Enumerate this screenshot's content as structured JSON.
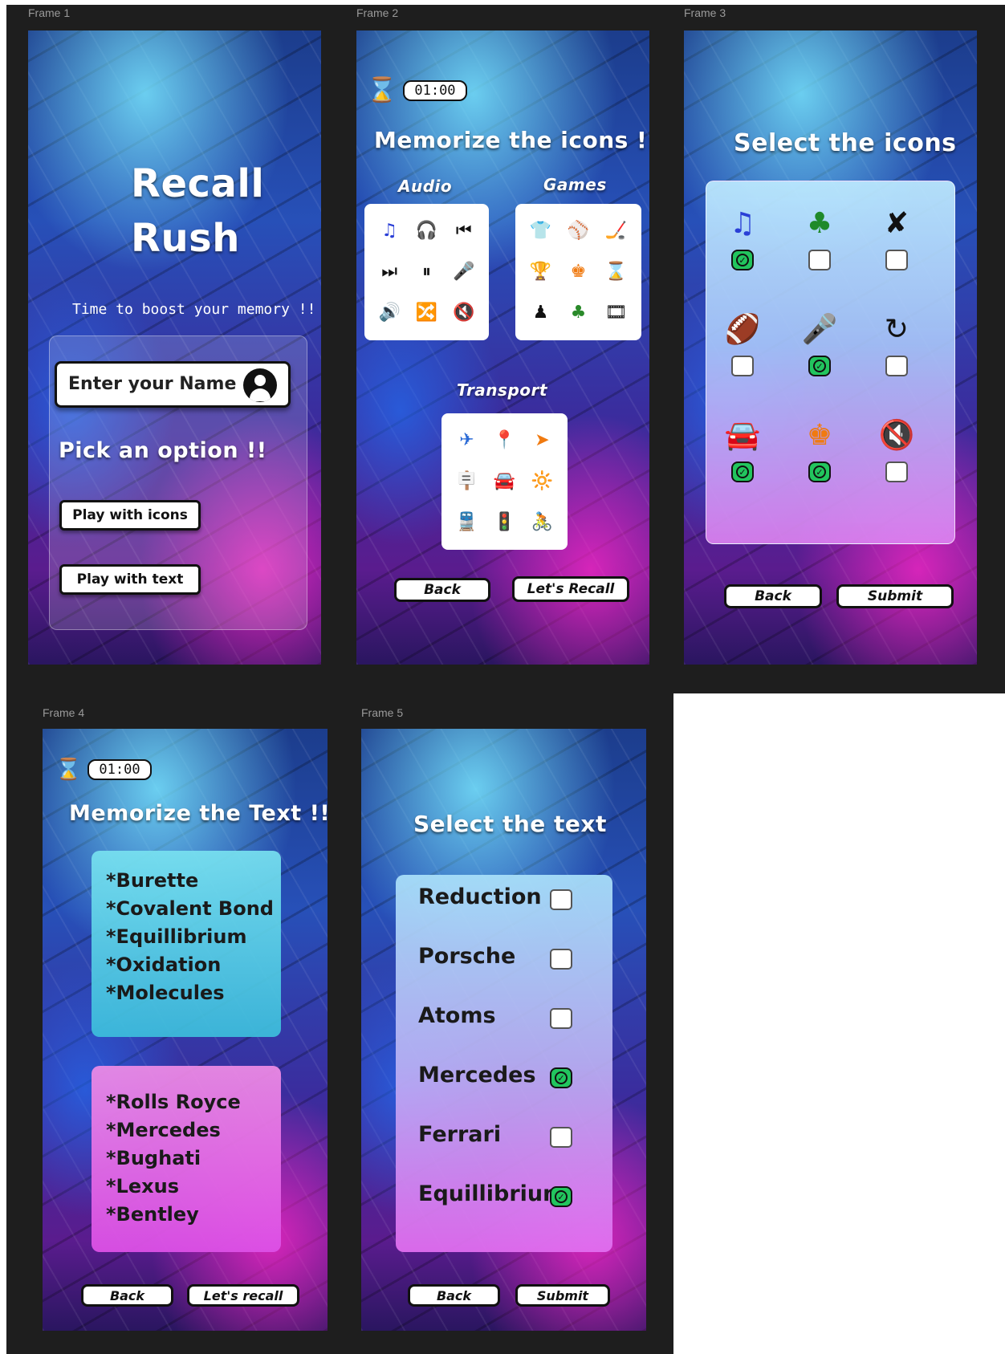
{
  "frame1": {
    "label": "Frame 1",
    "title_line1": "Recall",
    "title_line2": "Rush",
    "tagline": "Time to boost your memory !!",
    "name_placeholder": "Enter your Name",
    "pick_label": "Pick an option !!",
    "btn_icons": "Play with icons",
    "btn_text": "Play with text"
  },
  "frame2": {
    "label": "Frame 2",
    "timer": "01:00",
    "heading": "Memorize the icons !!",
    "audio_label": "Audio",
    "games_label": "Games",
    "transport_label": "Transport",
    "back": "Back",
    "recall": "Let's Recall",
    "audio_icons": [
      {
        "name": "music-note-icon",
        "glyph": "♫",
        "color": "#2a3fd6"
      },
      {
        "name": "headphones-icon",
        "glyph": "🎧",
        "color": "#111111"
      },
      {
        "name": "skip-back-icon",
        "glyph": "⏮",
        "color": "#111111"
      },
      {
        "name": "skip-forward-icon",
        "glyph": "⏭",
        "color": "#111111"
      },
      {
        "name": "pause-icon",
        "glyph": "⏸",
        "color": "#111111"
      },
      {
        "name": "microphone-icon",
        "glyph": "🎤",
        "color": "#d61f1f"
      },
      {
        "name": "volume-icon",
        "glyph": "🔊",
        "color": "#f4b400"
      },
      {
        "name": "shuffle-icon",
        "glyph": "🔀",
        "color": "#2fa84f"
      },
      {
        "name": "mute-icon",
        "glyph": "🔇",
        "color": "#d61f1f"
      }
    ],
    "games_icons": [
      {
        "name": "shirt-icon",
        "glyph": "👕",
        "color": "#a020c8"
      },
      {
        "name": "baseball-icon",
        "glyph": "⚾",
        "color": "#111111"
      },
      {
        "name": "hockey-icon",
        "glyph": "🏒",
        "color": "#e08a00"
      },
      {
        "name": "trophy-icon",
        "glyph": "🏆",
        "color": "#f4b400"
      },
      {
        "name": "chess-king-icon",
        "glyph": "♚",
        "color": "#f07a10"
      },
      {
        "name": "hourglass-icon",
        "glyph": "⌛",
        "color": "#111111"
      },
      {
        "name": "chess-pawn-icon",
        "glyph": "♟",
        "color": "#111111"
      },
      {
        "name": "club-icon",
        "glyph": "♣",
        "color": "#2a8a2a"
      },
      {
        "name": "film-icon",
        "glyph": "🎞",
        "color": "#111111"
      }
    ],
    "transport_icons": [
      {
        "name": "plane-icon",
        "glyph": "✈",
        "color": "#2a6ad6"
      },
      {
        "name": "location-pin-icon",
        "glyph": "📍",
        "color": "#e0405a"
      },
      {
        "name": "navigation-arrow-icon",
        "glyph": "➤",
        "color": "#f07a10"
      },
      {
        "name": "signpost-icon",
        "glyph": "🪧",
        "color": "#8a5a20"
      },
      {
        "name": "car-icon",
        "glyph": "🚘",
        "color": "#111111"
      },
      {
        "name": "headlight-icon",
        "glyph": "🔆",
        "color": "#f4c400"
      },
      {
        "name": "train-icon",
        "glyph": "🚆",
        "color": "#111111"
      },
      {
        "name": "traffic-light-icon",
        "glyph": "🚦",
        "color": "#e02020"
      },
      {
        "name": "cyclist-icon",
        "glyph": "🚴",
        "color": "#111111"
      }
    ]
  },
  "frame3": {
    "label": "Frame 3",
    "heading": "Select the icons",
    "back": "Back",
    "submit": "Submit",
    "items": [
      {
        "name": "music-note-icon",
        "glyph": "♫",
        "color": "#2a3fd6",
        "checked": true
      },
      {
        "name": "club-icon",
        "glyph": "♣",
        "color": "#1f8a2a",
        "checked": false
      },
      {
        "name": "navigation-off-icon",
        "glyph": "✘",
        "color": "#111111",
        "checked": false
      },
      {
        "name": "football-icon",
        "glyph": "🏈",
        "color": "#111111",
        "checked": false
      },
      {
        "name": "microphone-icon",
        "glyph": "🎤",
        "color": "#d61f1f",
        "checked": true
      },
      {
        "name": "redo-icon",
        "glyph": "↻",
        "color": "#111111",
        "checked": false
      },
      {
        "name": "car-icon",
        "glyph": "🚘",
        "color": "#111111",
        "checked": true
      },
      {
        "name": "chess-king-icon",
        "glyph": "♚",
        "color": "#f07a10",
        "checked": true
      },
      {
        "name": "volume-mute-icon",
        "glyph": "🔇",
        "color": "#111111",
        "checked": false
      }
    ]
  },
  "frame4": {
    "label": "Frame 4",
    "timer": "01:00",
    "heading": "Memorize the Text !!",
    "list1": [
      "*Burette",
      "*Covalent Bond",
      "*Equillibrium",
      "*Oxidation",
      "*Molecules"
    ],
    "list2": [
      "*Rolls Royce",
      "*Mercedes",
      "*Bughati",
      "*Lexus",
      "*Bentley"
    ],
    "back": "Back",
    "recall": "Let's recall"
  },
  "frame5": {
    "label": "Frame 5",
    "heading": "Select the text",
    "back": "Back",
    "submit": "Submit",
    "items": [
      {
        "text": "Reduction",
        "checked": false
      },
      {
        "text": "Porsche",
        "checked": false
      },
      {
        "text": "Atoms",
        "checked": false
      },
      {
        "text": "Mercedes",
        "checked": true
      },
      {
        "text": "Ferrari",
        "checked": false
      },
      {
        "text": "Equillibrium",
        "checked": true
      }
    ]
  }
}
